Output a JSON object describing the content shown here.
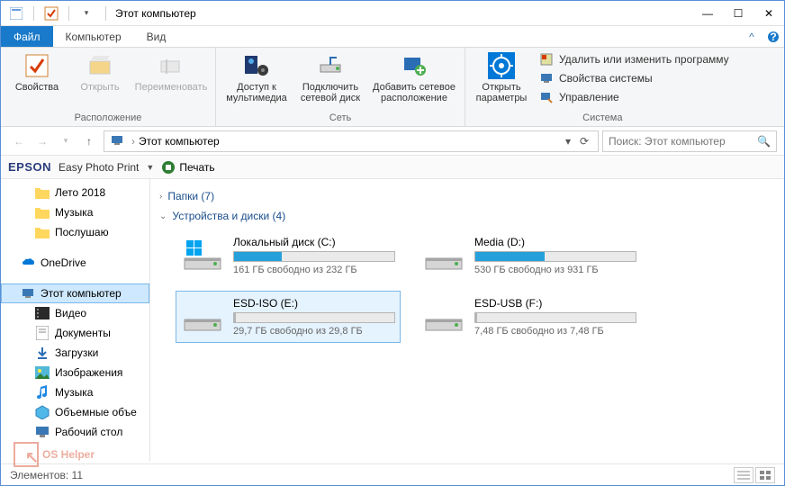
{
  "titlebar": {
    "title": "Этот компьютер"
  },
  "win": {
    "min": "—",
    "max": "☐",
    "close": "✕"
  },
  "tabs": {
    "file": "Файл",
    "computer": "Компьютер",
    "view": "Вид"
  },
  "ribbon": {
    "loc": {
      "props": "Свойства",
      "open": "Открыть",
      "rename": "Переименовать",
      "group": "Расположение"
    },
    "net": {
      "media": "Доступ к\nмультимедиа",
      "netdrive": "Подключить\nсетевой диск",
      "addnet": "Добавить сетевое\nрасположение",
      "group": "Сеть"
    },
    "sys": {
      "params": "Открыть\nпараметры",
      "uninstall": "Удалить или изменить программу",
      "sysprops": "Свойства системы",
      "manage": "Управление",
      "group": "Система"
    }
  },
  "addr": {
    "path": "Этот компьютер"
  },
  "search": {
    "placeholder": "Поиск: Этот компьютер"
  },
  "epson": {
    "logo": "EPSON",
    "app": "Easy Photo Print",
    "print": "Печать"
  },
  "tree": {
    "quick": [
      "Лето 2018",
      "Музыка",
      "Послушаю"
    ],
    "onedrive": "OneDrive",
    "thispc": "Этот компьютер",
    "pcchildren": [
      "Видео",
      "Документы",
      "Загрузки",
      "Изображения",
      "Музыка",
      "Объемные объе",
      "Рабочий стол"
    ]
  },
  "content": {
    "folders_label": "Папки (7)",
    "drives_label": "Устройства и диски (4)",
    "drives": [
      {
        "name": "Локальный диск (C:)",
        "free": "161 ГБ свободно из 232 ГБ",
        "pct": 30,
        "color": "#26a0da",
        "os": true
      },
      {
        "name": "Media (D:)",
        "free": "530 ГБ свободно из 931 ГБ",
        "pct": 43,
        "color": "#26a0da",
        "os": false
      },
      {
        "name": "ESD-ISO (E:)",
        "free": "29,7 ГБ свободно из 29,8 ГБ",
        "pct": 1,
        "color": "#b5b5b5",
        "os": false,
        "sel": true
      },
      {
        "name": "ESD-USB (F:)",
        "free": "7,48 ГБ свободно из 7,48 ГБ",
        "pct": 1,
        "color": "#b5b5b5",
        "os": false
      }
    ]
  },
  "status": {
    "items": "Элементов: 11"
  },
  "watermark": "OS Helper"
}
